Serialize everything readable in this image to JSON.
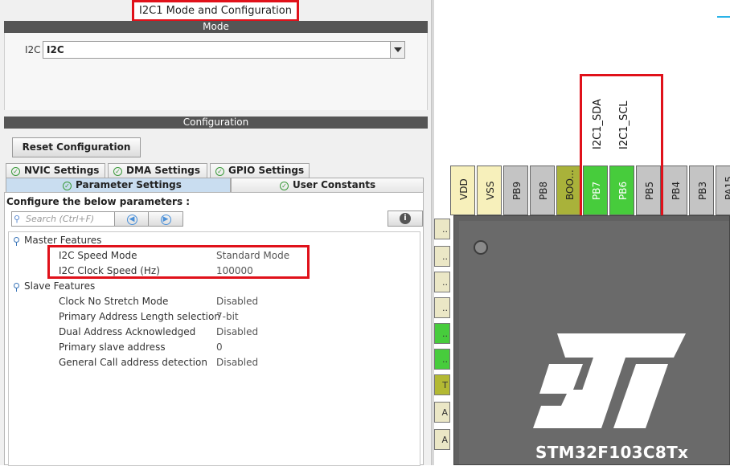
{
  "panel_title": "I2C1 Mode and Configuration",
  "mode": {
    "header": "Mode",
    "i2c_label": "I2C",
    "i2c_value": "I2C"
  },
  "configuration": {
    "header": "Configuration",
    "reset_button": "Reset Configuration",
    "tabs_row1": [
      "NVIC Settings",
      "DMA Settings",
      "GPIO Settings"
    ],
    "tabs_row2": [
      "Parameter Settings",
      "User Constants"
    ],
    "active_tab": "Parameter Settings",
    "params_caption": "Configure the below parameters :",
    "search_placeholder": "Search (Ctrl+F)",
    "groups": [
      {
        "name": "Master Features",
        "params": [
          {
            "name": "I2C Speed Mode",
            "value": "Standard Mode"
          },
          {
            "name": "I2C Clock Speed (Hz)",
            "value": "100000"
          }
        ]
      },
      {
        "name": "Slave Features",
        "params": [
          {
            "name": "Clock No Stretch Mode",
            "value": "Disabled"
          },
          {
            "name": "Primary Address Length selection",
            "value": "7-bit"
          },
          {
            "name": "Dual Address Acknowledged",
            "value": "Disabled"
          },
          {
            "name": "Primary slave address",
            "value": "0"
          },
          {
            "name": "General Call address detection",
            "value": "Disabled"
          }
        ]
      }
    ]
  },
  "pinout": {
    "top_pins": [
      "VDD",
      "VSS",
      "PB9",
      "PB8",
      "BOO...",
      "PB7",
      "PB6",
      "PB5",
      "PB4",
      "PB3",
      "PA15"
    ],
    "signal_labels": [
      "I2C1_SDA",
      "I2C1_SCL"
    ],
    "side_pins": [
      "..",
      "..",
      "..",
      "..",
      "..",
      "..",
      "T",
      "A",
      "A"
    ],
    "chip_name": "STM32F103C8Tx",
    "colors": {
      "assigned": "#47cc3c",
      "power": "#f7f0bb",
      "boot": "#a9b23a",
      "unassigned": "#c4c4c4",
      "highlight": "#e0111a"
    }
  }
}
